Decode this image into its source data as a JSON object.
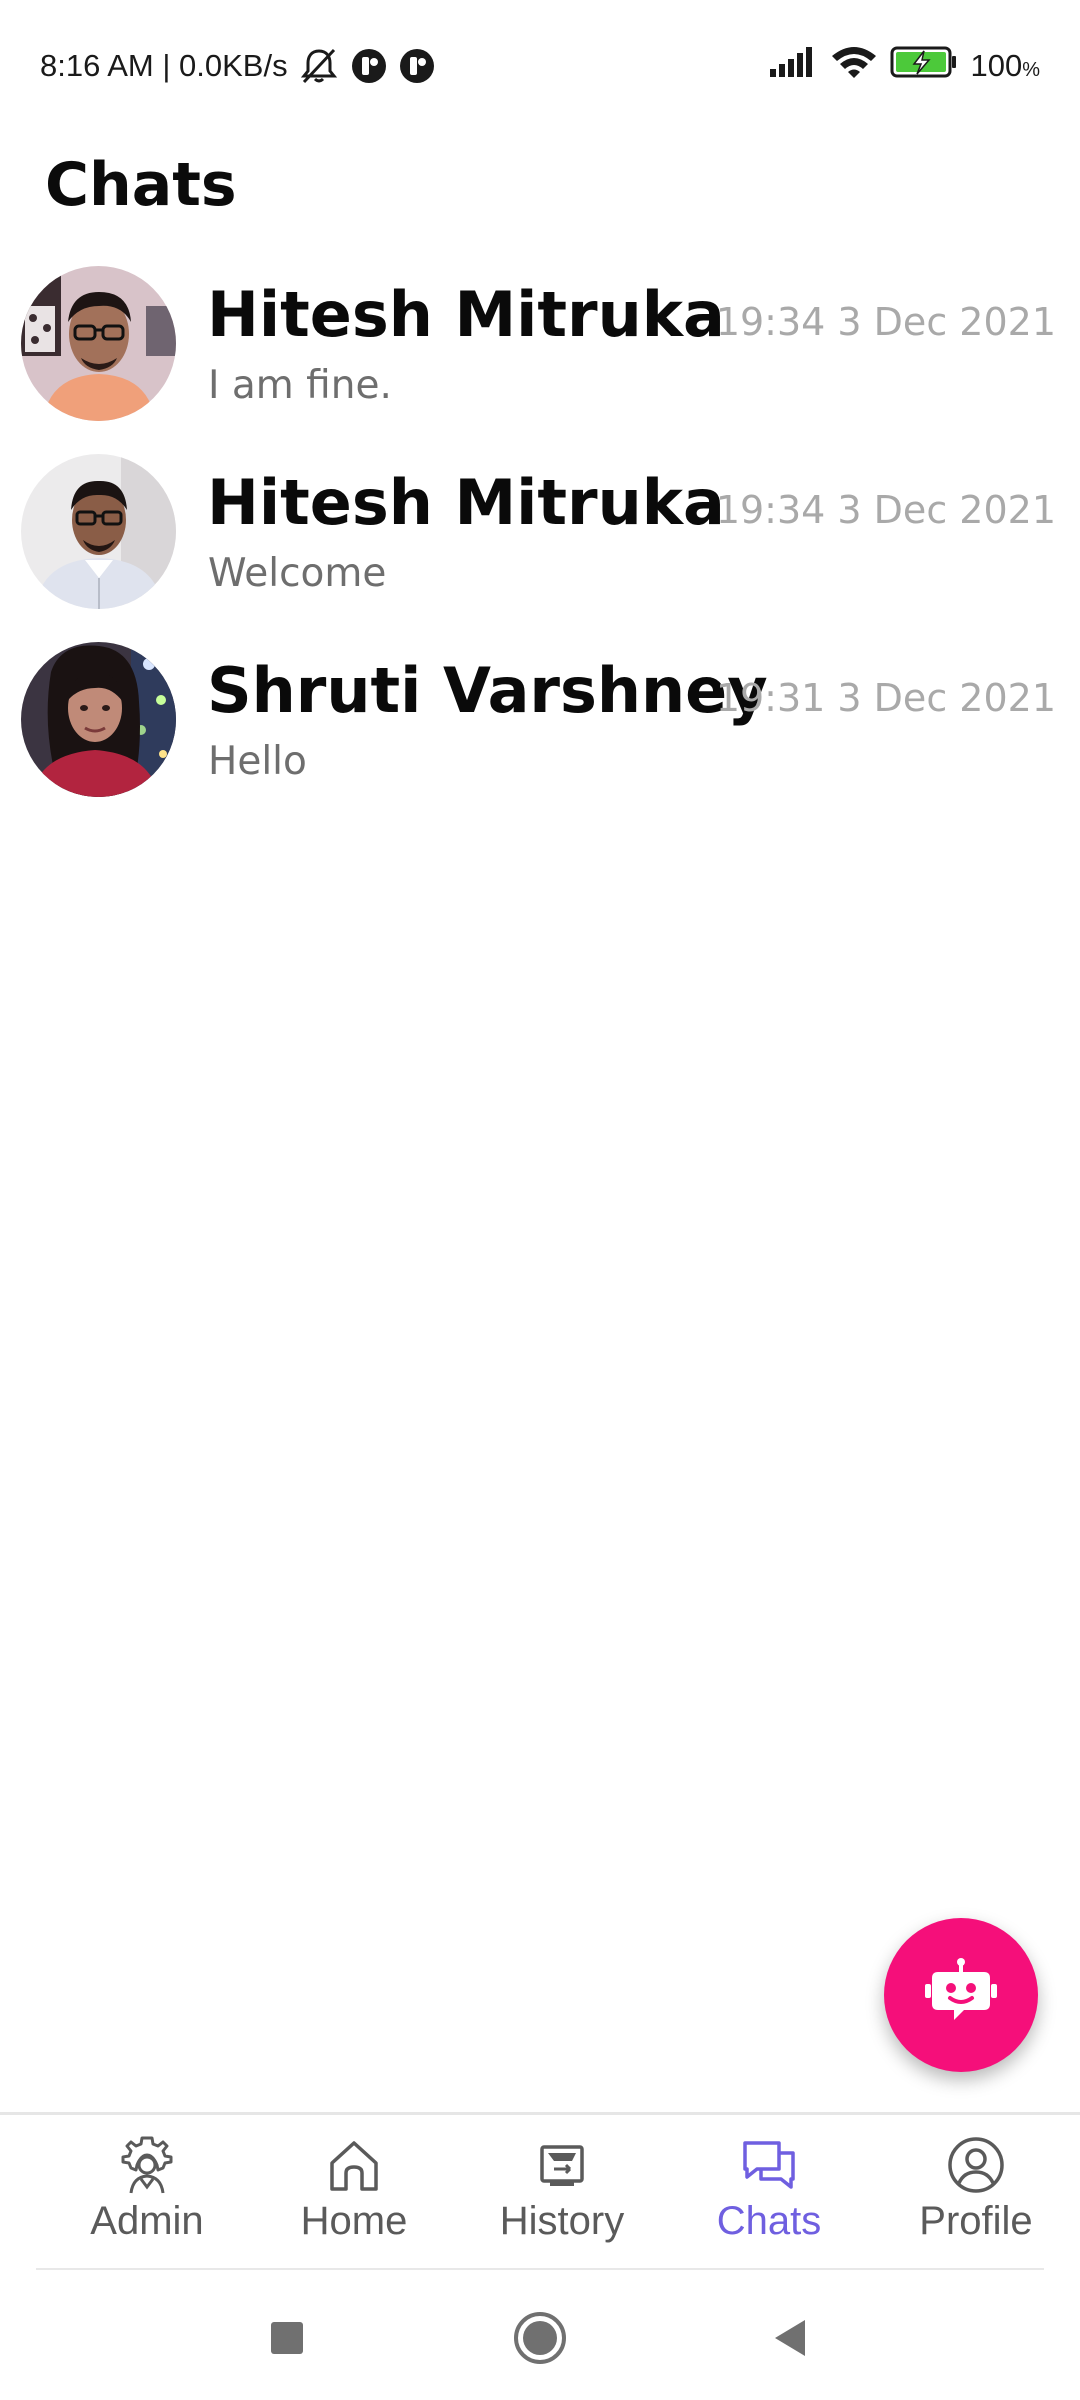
{
  "status_bar": {
    "time_speed": "8:16 AM | 0.0KB/s",
    "battery_percent": "100",
    "battery_unit": "%",
    "icons": [
      "mute-icon",
      "app-notification-icon",
      "app-notification-icon",
      "signal-icon",
      "wifi-icon",
      "battery-charging-icon"
    ]
  },
  "header": {
    "title": "Chats"
  },
  "chats": [
    {
      "name": "Hitesh Mitruka",
      "time": "19:34 3 Dec 2021",
      "message": "I am fine."
    },
    {
      "name": "Hitesh Mitruka",
      "time": "19:34 3 Dec 2021",
      "message": "Welcome"
    },
    {
      "name": "Shruti Varshney",
      "time": "19:31 3 Dec 2021",
      "message": "Hello"
    }
  ],
  "fab": {
    "icon": "chatbot-icon",
    "color": "#f50f7a"
  },
  "bottom_nav": {
    "items": [
      {
        "label": "Admin",
        "icon": "admin-gear-icon",
        "active": false
      },
      {
        "label": "Home",
        "icon": "home-icon",
        "active": false
      },
      {
        "label": "History",
        "icon": "history-icon",
        "active": false
      },
      {
        "label": "Chats",
        "icon": "chats-icon",
        "active": true
      },
      {
        "label": "Profile",
        "icon": "profile-icon",
        "active": false
      }
    ],
    "active_color": "#6f5fe0",
    "inactive_color": "#5a5a5a"
  },
  "system_nav": {
    "icons": [
      "recents-square-icon",
      "home-circle-icon",
      "back-triangle-icon"
    ]
  }
}
